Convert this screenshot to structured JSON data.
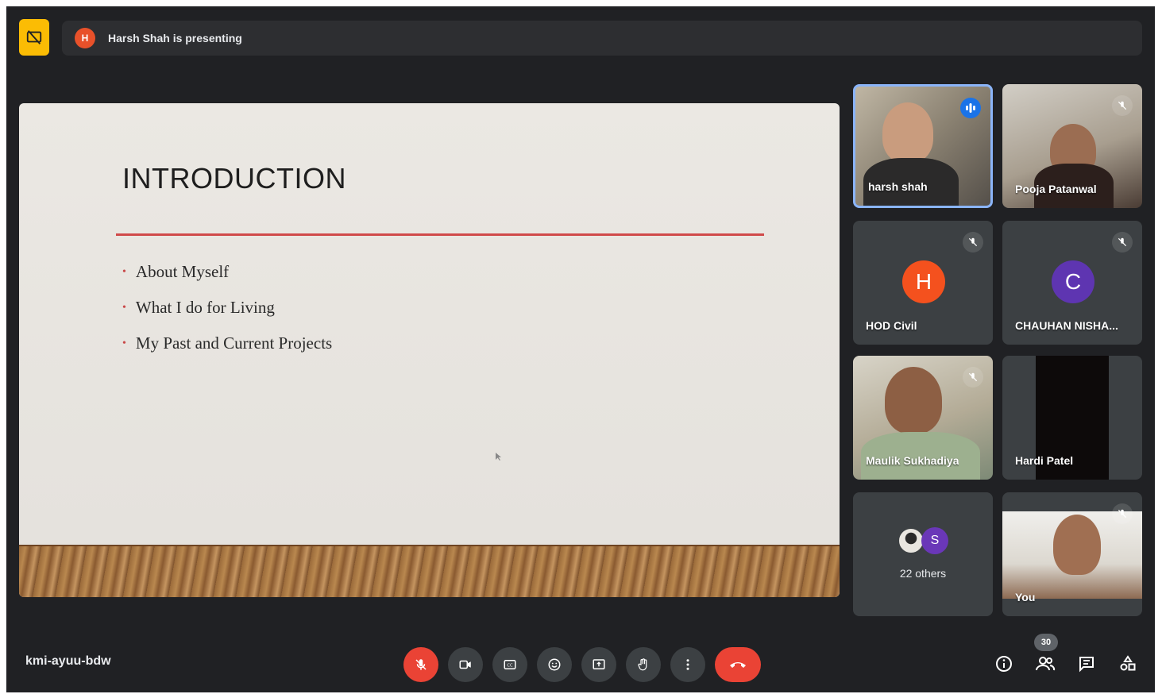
{
  "banner": {
    "presenter_initial": "H",
    "text": "Harsh Shah is presenting"
  },
  "slide": {
    "title": "INTRODUCTION",
    "bullets": [
      "About Myself",
      "What I do for Living",
      "My Past and Current Projects"
    ]
  },
  "participants": [
    {
      "name": "harsh shah",
      "mic": "speaking",
      "video": true
    },
    {
      "name": "Pooja Patanwal",
      "mic": "muted",
      "video": true
    },
    {
      "name": "HOD Civil",
      "mic": "muted",
      "video": false,
      "initial": "H",
      "color": "#f4511e"
    },
    {
      "name": "CHAUHAN NISHA...",
      "mic": "muted",
      "video": false,
      "initial": "C",
      "color": "#5e35b1"
    },
    {
      "name": "Maulik Sukhadiya",
      "mic": "muted",
      "video": true
    },
    {
      "name": "Hardi Patel",
      "video": true
    },
    {
      "name": "You",
      "mic": "muted",
      "video": true
    }
  ],
  "others": {
    "initial": "S",
    "label": "22 others"
  },
  "meeting_code": "kmi-ayuu-bdw",
  "people_count": "30",
  "icons": {
    "present": "stop-presenting-icon",
    "mic": "mic-off-icon",
    "camera": "camera-icon",
    "captions": "captions-icon",
    "emoji": "emoji-icon",
    "present_screen": "present-screen-icon",
    "hand": "raise-hand-icon",
    "more": "more-options-icon",
    "end_call": "end-call-icon",
    "info": "info-icon",
    "people": "people-icon",
    "chat": "chat-icon",
    "activities": "activities-icon"
  },
  "colors": {
    "background": "#202124",
    "tile": "#3c4043",
    "accent_red": "#ea4335",
    "speaking_border": "#8ab4f8",
    "present_yellow": "#fbbc04"
  }
}
